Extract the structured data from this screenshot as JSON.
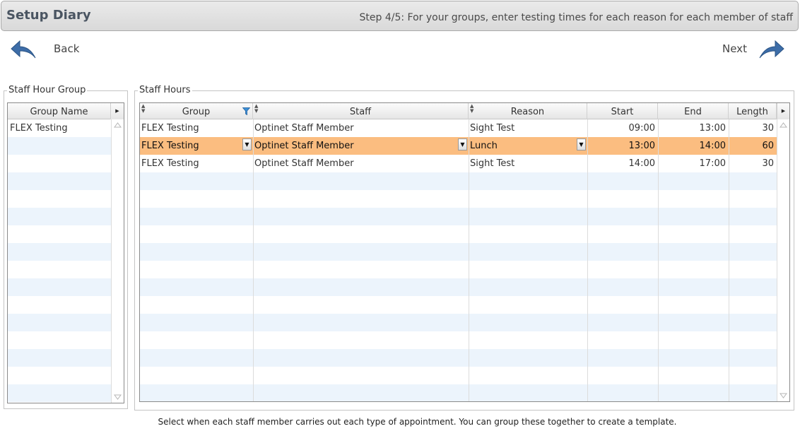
{
  "header": {
    "title": "Setup Diary",
    "step": "Step 4/5: For your groups, enter testing times for each reason for each member of staff"
  },
  "nav": {
    "back_label": "Back",
    "next_label": "Next"
  },
  "group_panel": {
    "title": "Staff Hour Group",
    "column": "Group Name",
    "rows": [
      "FLEX Testing"
    ]
  },
  "hours_panel": {
    "title": "Staff Hours",
    "columns": [
      "Group",
      "Staff",
      "Reason",
      "Start",
      "End",
      "Length"
    ],
    "rows": [
      {
        "group": "FLEX Testing",
        "staff": "Optinet Staff Member",
        "reason": "Sight Test",
        "start": "09:00",
        "end": "13:00",
        "length": "30"
      },
      {
        "group": "FLEX Testing",
        "staff": "Optinet Staff Member",
        "reason": "Lunch",
        "start": "13:00",
        "end": "14:00",
        "length": "60"
      },
      {
        "group": "FLEX Testing",
        "staff": "Optinet Staff Member",
        "reason": "Sight Test",
        "start": "14:00",
        "end": "17:00",
        "length": "30"
      }
    ],
    "selected_row": 1
  },
  "footer": {
    "text": "Select when each staff member carries out each type of appointment. You can group these together to create a template."
  },
  "colors": {
    "selected_row": "#fbbd80",
    "alt_row": "#ecf4fc",
    "arrow": "#3d6da8"
  },
  "icons": [
    "back-arrow-icon",
    "next-arrow-icon",
    "filter-icon",
    "sort-icon",
    "dropdown-arrow-icon",
    "scroll-up-icon",
    "scroll-down-icon"
  ]
}
